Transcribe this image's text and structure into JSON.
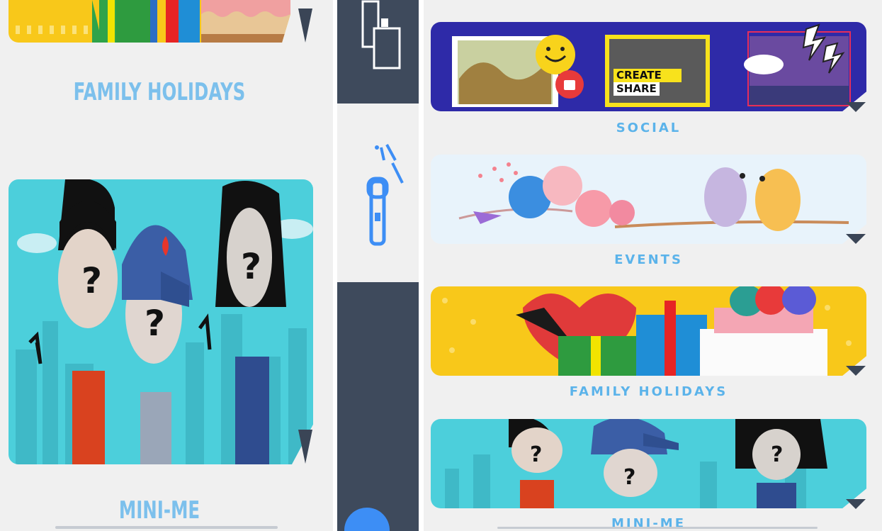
{
  "left": {
    "family_holidays_label": "FAMILY HOLIDAYS",
    "mini_me_label": "MINI-ME"
  },
  "right": {
    "categories": [
      {
        "label": "SOCIAL"
      },
      {
        "label": "EVENTS"
      },
      {
        "label": "FAMILY HOLIDAYS"
      },
      {
        "label": "MINI-ME"
      }
    ],
    "social_badge_line1": "CREATE",
    "social_badge_line2": "SHARE"
  },
  "icons": {
    "expand": "chevron-down-icon",
    "tool": "flashlight-icon"
  },
  "colors": {
    "accent_label": "#5bb3ea",
    "dark_bar": "#3e4a5c",
    "social_bg": "#2e2aa8",
    "events_bg": "#e8f3fb",
    "holidays_bg": "#f8c81a",
    "mini_me_bg": "#4ccfdb"
  }
}
